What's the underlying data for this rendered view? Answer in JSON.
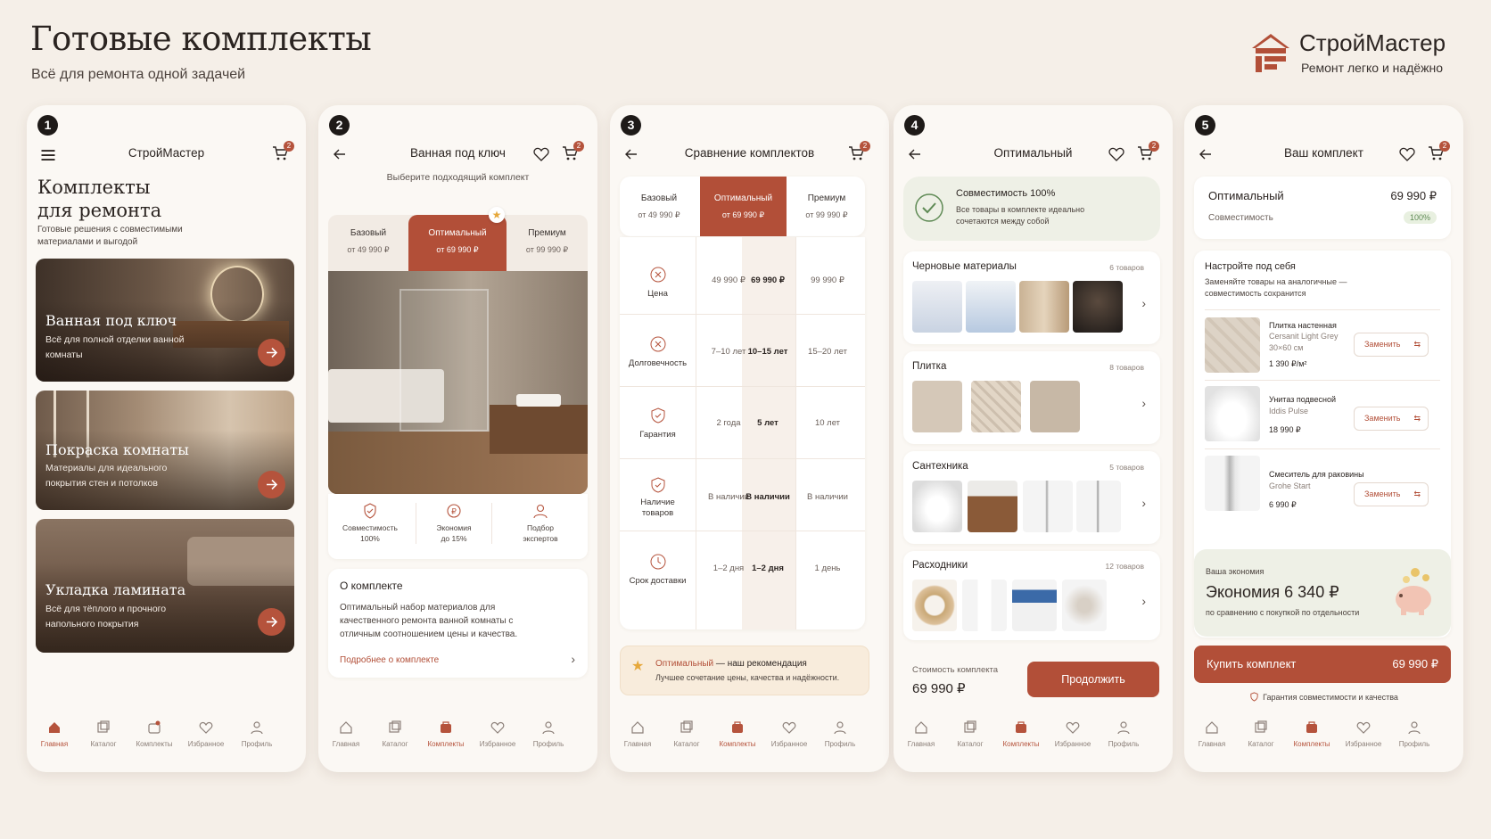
{
  "header": {
    "title": "Готовые комплекты",
    "subtitle": "Всё для ремонта одной задачей"
  },
  "brand": {
    "name": "СтройМастер",
    "tagline": "Ремонт легко и надёжно",
    "color": "#b24f38"
  },
  "nav": {
    "home": "Главная",
    "catalog": "Каталог",
    "kits": "Комплекты",
    "favorites": "Избранное",
    "profile": "Профиль"
  },
  "cart_count": "2",
  "screen1": {
    "step": "1",
    "title": "СтройМастер",
    "heading_line1": "Комплекты",
    "heading_line2": "для ремонта",
    "description": "Готовые решения с совместимыми материалами и выгодой",
    "cards": [
      {
        "title": "Ванная под ключ",
        "desc": "Всё для полной отделки ванной комнаты"
      },
      {
        "title": "Покраска комнаты",
        "desc": "Материалы для идеального покрытия стен и потолков"
      },
      {
        "title": "Укладка ламината",
        "desc": "Всё для тёплого и прочного напольного покрытия"
      }
    ]
  },
  "screen2": {
    "step": "2",
    "title": "Ванная под ключ",
    "prompt": "Выберите подходящий комплект",
    "tabs": [
      {
        "name": "Базовый",
        "price": "от 49 990 ₽"
      },
      {
        "name": "Оптимальный",
        "price": "от 69 990 ₽"
      },
      {
        "name": "Премиум",
        "price": "от 99 990 ₽"
      }
    ],
    "features": [
      {
        "l1": "Совместимость",
        "l2": "100%"
      },
      {
        "l1": "Экономия",
        "l2": "до 15%"
      },
      {
        "l1": "Подбор",
        "l2": "экспертов"
      }
    ],
    "about_title": "О комплекте",
    "about_text": "Оптимальный набор материалов для качественного ремонта ванной комнаты с отличным соотношением цены и качества.",
    "about_link": "Подробнее о комплекте"
  },
  "screen3": {
    "step": "3",
    "title": "Сравнение комплектов",
    "cols": [
      {
        "name": "Базовый",
        "price": "от 49 990 ₽"
      },
      {
        "name": "Оптимальный",
        "price": "от 69 990 ₽"
      },
      {
        "name": "Премиум",
        "price": "от 99 990 ₽"
      }
    ],
    "rows": [
      {
        "label": "Цена",
        "v1": "49 990 ₽",
        "v2": "69 990 ₽",
        "v3": "99 990 ₽"
      },
      {
        "label": "Долговечность",
        "v1": "7–10 лет",
        "v2": "10–15 лет",
        "v3": "15–20 лет"
      },
      {
        "label": "Гарантия",
        "v1": "2 года",
        "v2": "5 лет",
        "v3": "10 лет"
      },
      {
        "label": "Наличие товаров",
        "v1": "В наличии",
        "v2": "В наличии",
        "v3": "В наличии"
      },
      {
        "label": "Срок доставки",
        "v1": "1–2 дня",
        "v2": "1–2 дня",
        "v3": "1 день"
      }
    ],
    "rec_name": "Оптимальный",
    "rec_tail": " — наш рекомендация",
    "rec_text": "Лучшее сочетание цены, качества и надёжности."
  },
  "screen4": {
    "step": "4",
    "title": "Оптимальный",
    "compat_title": "Совместимость 100%",
    "compat_text": "Все товары в комплекте идеально сочетаются между собой",
    "sections": [
      {
        "name": "Черновые материалы",
        "count": "6 товаров"
      },
      {
        "name": "Плитка",
        "count": "8 товаров"
      },
      {
        "name": "Сантехника",
        "count": "5 товаров"
      },
      {
        "name": "Расходники",
        "count": "12 товаров"
      }
    ],
    "cost_label": "Стоимость комплекта",
    "cost_value": "69 990 ₽",
    "continue": "Продолжить"
  },
  "screen5": {
    "step": "5",
    "title": "Ваш комплект",
    "kit_name": "Оптимальный",
    "kit_price": "69 990 ₽",
    "compat_label": "Совместимость",
    "compat_value": "100%",
    "customize_title": "Настройте под себя",
    "customize_text": "Заменяйте товары на аналогичные — совместимость сохранится",
    "items": [
      {
        "name": "Плитка настенная",
        "sub1": "Cersanit Light Grey",
        "sub2": "30×60 см",
        "price": "1 390 ₽/м²"
      },
      {
        "name": "Унитаз подвесной",
        "sub1": "Iddis Pulse",
        "sub2": "",
        "price": "18 990 ₽"
      },
      {
        "name": "Смеситель для раковины",
        "sub1": "Grohe Start",
        "sub2": "",
        "price": "6 990 ₽"
      }
    ],
    "replace": "Заменить",
    "savings_label": "Ваша экономия",
    "savings_value": "Экономия 6 340 ₽",
    "savings_note": "по сравнению с покупкой по отдельности",
    "buy_label": "Купить комплект",
    "buy_price": "69 990 ₽",
    "guarantee": "Гарантия совместимости и качества"
  }
}
